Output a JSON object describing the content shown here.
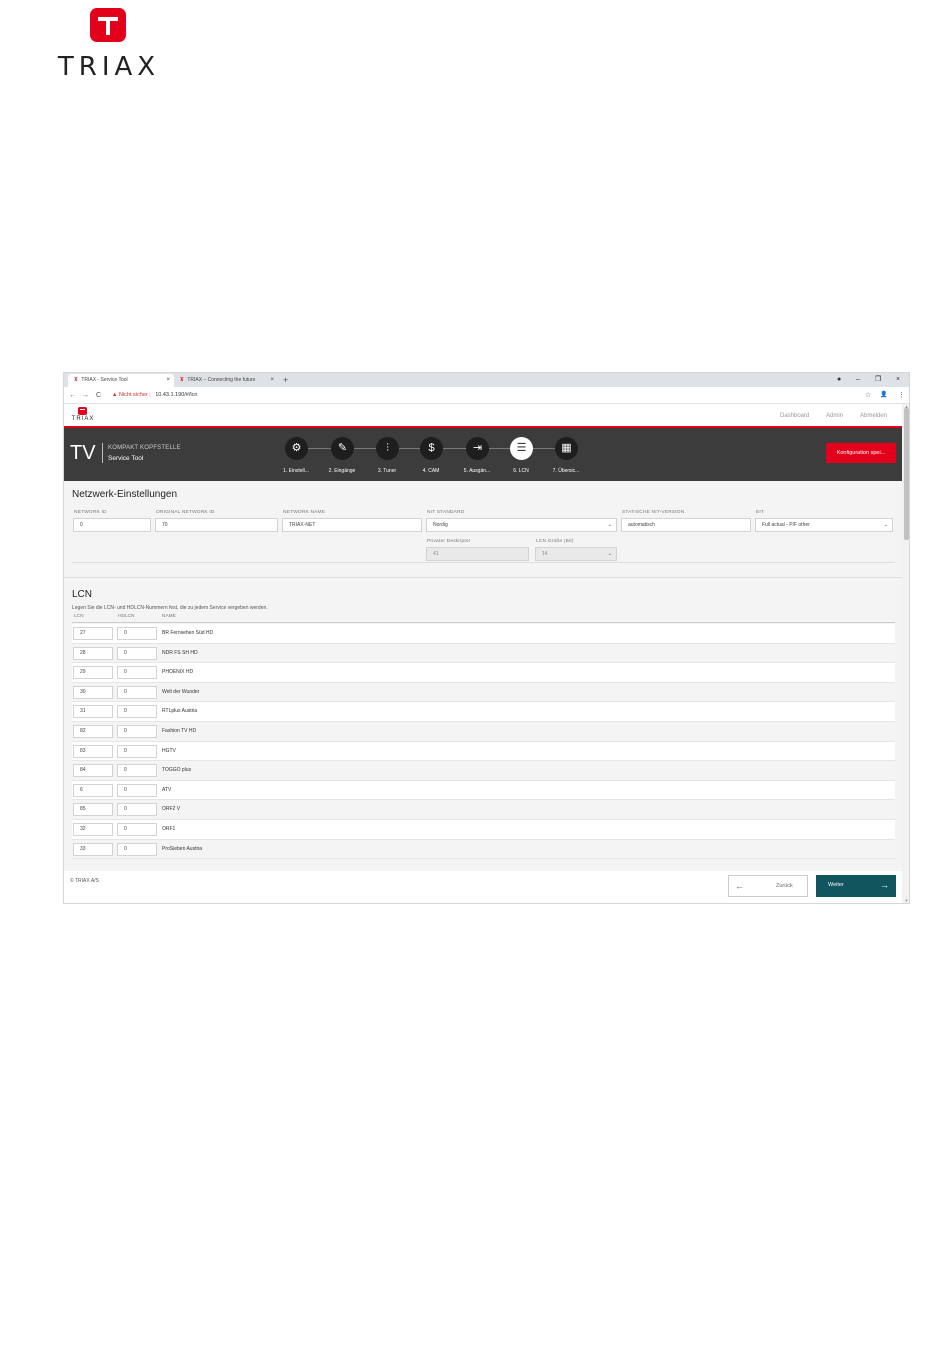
{
  "doc_logo": {
    "wordmark": "TRIAX"
  },
  "browser": {
    "tabs": [
      {
        "title": "TRIAX - Service Tool",
        "close": "×"
      },
      {
        "title": "TRIAX – Connecting the future",
        "close": "×"
      }
    ],
    "new_tab": "+",
    "window_controls": [
      "●",
      "–",
      "❐",
      "×"
    ],
    "nav": {
      "back": "←",
      "forward": "→",
      "reload": "C"
    },
    "security_warning": "Nicht sicher",
    "url": "10.43.1.190/#/lcn",
    "right_icons": {
      "star": "☆",
      "profile": "👤",
      "menu": "⋮"
    }
  },
  "app": {
    "logo_text": "TRIAX",
    "top_nav": {
      "dashboard": "Dashboard",
      "admin": "Admin",
      "logout": "Abmelden"
    },
    "tv": "TV",
    "brand_line1": "KOMPAKT KOPFSTELLE",
    "brand_line2": "Service Tool",
    "steps": [
      {
        "label": "1. Einstell...",
        "icon": "⚙"
      },
      {
        "label": "2. Eingänge",
        "icon": "✎"
      },
      {
        "label": "3. Tuner",
        "icon": "⫶"
      },
      {
        "label": "4. CAM",
        "icon": "$"
      },
      {
        "label": "5. Ausgän...",
        "icon": "⇥"
      },
      {
        "label": "6. LCN",
        "icon": "☰"
      },
      {
        "label": "7. Übersic...",
        "icon": "▦"
      }
    ],
    "save_button": "Konfiguration spei..."
  },
  "network": {
    "title": "Netzwerk-Einstellungen",
    "labels": {
      "network_id": "NETWORK ID",
      "original_network_id": "ORIGINAL NETWORK ID",
      "network_name": "NETWORK NAME",
      "nit_standard": "NIT STANDARD",
      "static_nit": "STATISCHE NIT-VERSION",
      "eit": "EIT",
      "private_desc": "Privater Deskriptor",
      "lcn_size": "LCN Größe (Bit)"
    },
    "values": {
      "network_id": "0",
      "original_network_id": "70",
      "network_name": "TRIAX-NET",
      "nit_standard": "Nordig",
      "static_nit": "automatisch",
      "eit": "Full actual - P/F other",
      "private_desc": "41",
      "lcn_size": "14"
    }
  },
  "lcn": {
    "title": "LCN",
    "description": "Legen Sie die LCN- und HDLCN-Nummern fest, die zu jedem Service vergeben werden.",
    "columns": [
      "LCN",
      "HDLCN",
      "NAME"
    ],
    "rows": [
      {
        "lcn": "27",
        "hdlcn": "0",
        "name": "BR Fernsehen Süd HD"
      },
      {
        "lcn": "28",
        "hdlcn": "0",
        "name": "NDR FS SH HD"
      },
      {
        "lcn": "29",
        "hdlcn": "0",
        "name": "PHOENIX HD"
      },
      {
        "lcn": "30",
        "hdlcn": "0",
        "name": "Welt der Wunder"
      },
      {
        "lcn": "31",
        "hdlcn": "0",
        "name": "RTLplus Austria"
      },
      {
        "lcn": "82",
        "hdlcn": "0",
        "name": "Fashion TV HD"
      },
      {
        "lcn": "83",
        "hdlcn": "0",
        "name": "HGTV"
      },
      {
        "lcn": "84",
        "hdlcn": "0",
        "name": "TOGGO plus"
      },
      {
        "lcn": "6",
        "hdlcn": "0",
        "name": "ATV"
      },
      {
        "lcn": "85",
        "hdlcn": "0",
        "name": "ORF2 V"
      },
      {
        "lcn": "32",
        "hdlcn": "0",
        "name": "ORF1"
      },
      {
        "lcn": "33",
        "hdlcn": "0",
        "name": "ProSieben Austria"
      }
    ]
  },
  "footer": {
    "copyright": "© TRIAX A/S",
    "back": "Zurück",
    "next": "Weiter",
    "back_arrow": "←",
    "next_arrow": "→"
  },
  "colors": {
    "brand_red": "#e3001b",
    "dark_band": "#3c3c3c",
    "next_button": "#11555f"
  }
}
